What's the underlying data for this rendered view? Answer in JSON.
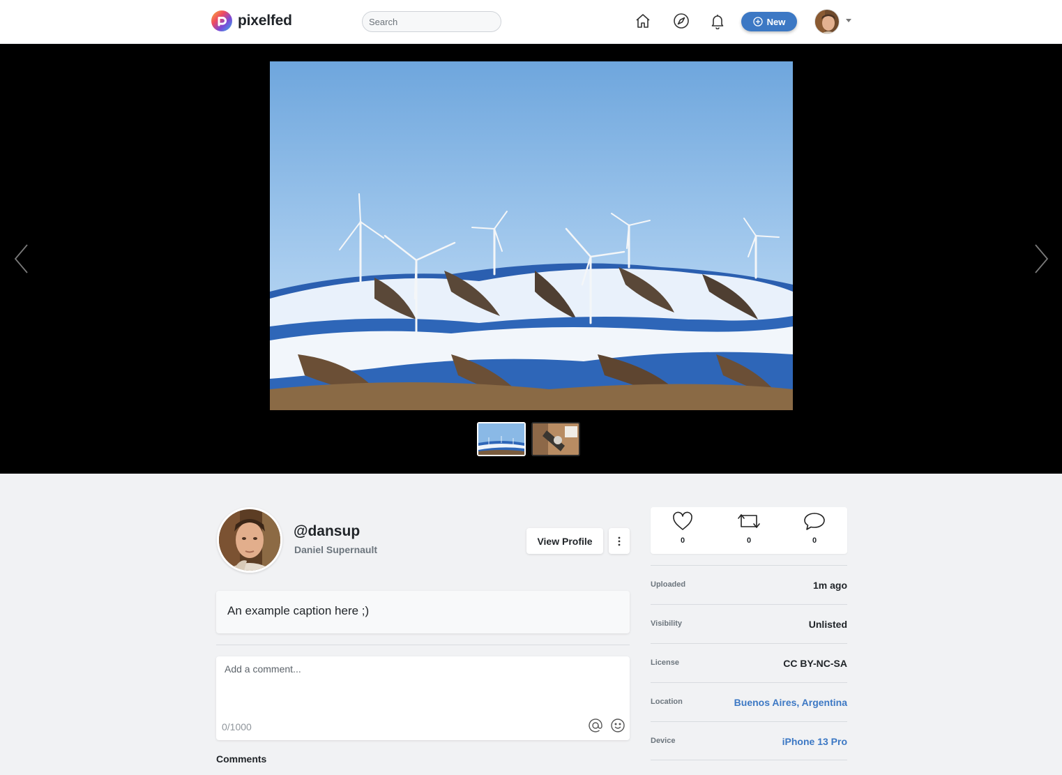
{
  "nav": {
    "brand": "pixelfed",
    "search_placeholder": "Search",
    "new_label": "New",
    "icons": [
      "home-icon",
      "explore-icon",
      "bell-icon"
    ],
    "accent": "#3c78c4"
  },
  "media": {
    "thumbnail_count": 2,
    "active_thumbnail": 1,
    "photo_subject": "wind turbines on snowy hills"
  },
  "post": {
    "username": "@dansup",
    "display_name": "Daniel Supernault",
    "view_profile_label": "View Profile",
    "caption": "An example caption here ;)",
    "comment_placeholder": "Add a comment...",
    "char_count": "0/1000",
    "comments_heading": "Comments"
  },
  "stats": {
    "likes": "0",
    "shares": "0",
    "comments": "0"
  },
  "meta": [
    {
      "label": "Uploaded",
      "value": "1m ago",
      "link": false
    },
    {
      "label": "Visibility",
      "value": "Unlisted",
      "link": false
    },
    {
      "label": "License",
      "value": "CC BY-NC-SA",
      "link": false
    },
    {
      "label": "Location",
      "value": "Buenos Aires, Argentina",
      "link": true
    },
    {
      "label": "Device",
      "value": "iPhone 13 Pro",
      "link": true
    }
  ]
}
